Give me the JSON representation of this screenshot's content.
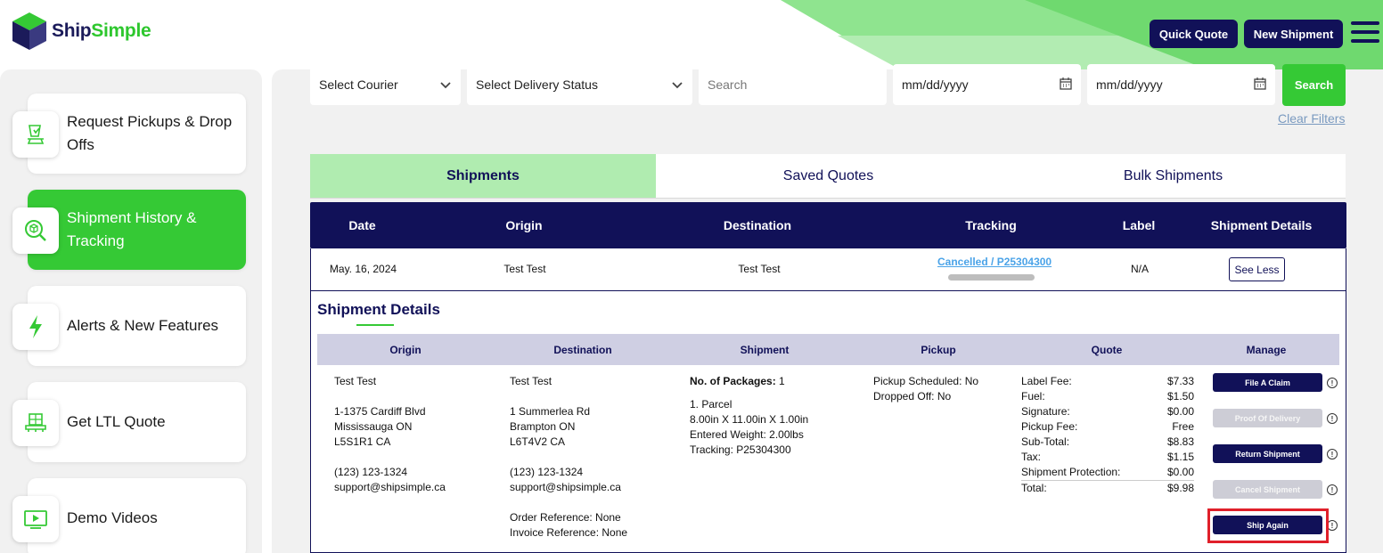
{
  "header": {
    "logo_text_1": "Ship",
    "logo_text_2": "Simple",
    "quick_quote": "Quick Quote",
    "new_shipment": "New Shipment"
  },
  "sidebar": {
    "items": [
      {
        "label": "Request Pickups & Drop Offs",
        "icon": "pickup-icon"
      },
      {
        "label": "Shipment History & Tracking",
        "icon": "history-tracking-icon"
      },
      {
        "label": "Alerts & New Features",
        "icon": "lightning-icon"
      },
      {
        "label": "Get LTL Quote",
        "icon": "pallet-icon"
      },
      {
        "label": "Demo Videos",
        "icon": "video-icon"
      }
    ]
  },
  "filters": {
    "courier": "Select Courier",
    "delivery_status": "Select Delivery Status",
    "search_placeholder": "Search",
    "date_from": "mm/dd/yyyy",
    "date_to": "mm/dd/yyyy",
    "search_button": "Search",
    "clear_filters": "Clear Filters"
  },
  "tabs": [
    "Shipments",
    "Saved Quotes",
    "Bulk Shipments"
  ],
  "table": {
    "headers": [
      "Date",
      "Origin",
      "Destination",
      "Tracking",
      "Label",
      "Shipment Details"
    ],
    "row": {
      "date": "May. 16, 2024",
      "origin": "Test Test",
      "destination": "Test Test",
      "tracking": "Cancelled / P25304300",
      "label": "N/A",
      "details_button": "See Less"
    }
  },
  "details": {
    "title": "Shipment Details",
    "headers": [
      "Origin",
      "Destination",
      "Shipment",
      "Pickup",
      "Quote",
      "Manage"
    ],
    "origin": {
      "name": "Test Test",
      "address1": "1-1375 Cardiff Blvd",
      "address2": "Mississauga ON",
      "postal": "L5S1R1 CA",
      "phone": "(123) 123-1324",
      "email": "support@shipsimple.ca"
    },
    "destination": {
      "name": "Test Test",
      "address1": "1 Summerlea Rd",
      "address2": "Brampton ON",
      "postal": "L6T4V2 CA",
      "phone": "(123) 123-1324",
      "email": "support@shipsimple.ca",
      "order_ref": "Order Reference: None",
      "invoice_ref": "Invoice Reference: None"
    },
    "shipment": {
      "packages_label": "No. of Packages:",
      "packages_value": "1",
      "parcel": "1. Parcel",
      "dims": "8.00in X 11.00in X 1.00in",
      "weight": "Entered Weight: 2.00lbs",
      "tracking": "Tracking: P25304300"
    },
    "pickup": {
      "scheduled": "Pickup Scheduled: No",
      "dropped": "Dropped Off: No"
    },
    "quote": [
      {
        "label": "Label Fee:",
        "value": "$7.33"
      },
      {
        "label": "Fuel:",
        "value": "$1.50"
      },
      {
        "label": "Signature:",
        "value": "$0.00"
      },
      {
        "label": "Pickup Fee:",
        "value": "Free"
      },
      {
        "label": "Sub-Total:",
        "value": "$8.83"
      },
      {
        "label": "Tax:",
        "value": "$1.15"
      },
      {
        "label": "Shipment Protection:",
        "value": "$0.00"
      },
      {
        "label": "Total:",
        "value": "$9.98"
      }
    ],
    "manage": [
      {
        "label": "File A Claim",
        "enabled": true
      },
      {
        "label": "Proof Of Delivery",
        "enabled": false
      },
      {
        "label": "Return Shipment",
        "enabled": true
      },
      {
        "label": "Cancel Shipment",
        "enabled": false
      },
      {
        "label": "Ship Again",
        "enabled": true
      }
    ],
    "info_glyph": "!"
  },
  "colors": {
    "navy": "#111158",
    "green": "#35c935",
    "light_green": "#b0ecb0",
    "highlight_red": "#e0202a"
  }
}
